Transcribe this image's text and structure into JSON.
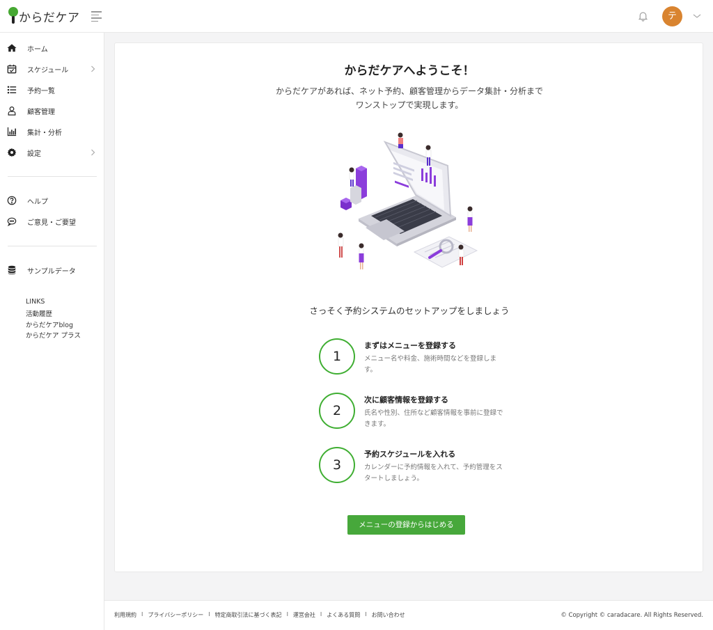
{
  "header": {
    "logo_text": "からだケア",
    "avatar_initial": "テ"
  },
  "sidebar": {
    "items": [
      {
        "label": "ホーム",
        "icon": "home-icon"
      },
      {
        "label": "スケジュール",
        "icon": "calendar-check-icon",
        "has_arrow": true
      },
      {
        "label": "予約一覧",
        "icon": "list-icon"
      },
      {
        "label": "顧客管理",
        "icon": "user-icon"
      },
      {
        "label": "集計・分析",
        "icon": "bar-chart-icon"
      },
      {
        "label": "設定",
        "icon": "gear-icon",
        "has_arrow": true
      }
    ],
    "help_items": [
      {
        "label": "ヘルプ",
        "icon": "question-circle-icon"
      },
      {
        "label": "ご意見・ご要望",
        "icon": "chat-bubble-icon"
      }
    ],
    "sample_data": {
      "label": "サンプルデータ",
      "icon": "database-icon"
    },
    "links_title": "LINKS",
    "links": [
      "活動履歴",
      "からだケアblog",
      "からだケア プラス"
    ]
  },
  "main": {
    "title": "からだケアへようこそ！",
    "desc_line1": "からだケアがあれば、ネット予約、顧客管理からデータ集計・分析まで",
    "desc_line2": "ワンストップで実現します。",
    "setup_text": "さっそく予約システムのセットアップをしましょう",
    "steps": [
      {
        "num": "1",
        "title": "まずはメニューを登録する",
        "desc": "メニュー名や料金、施術時間などを登録します。"
      },
      {
        "num": "2",
        "title": "次に顧客情報を登録する",
        "desc": "氏名や性別、住所など顧客情報を事前に登録できます。"
      },
      {
        "num": "3",
        "title": "予約スケジュールを入れる",
        "desc": "カレンダーに予約情報を入れて、予約管理をスタートしましょう。"
      }
    ],
    "cta_label": "メニューの登録からはじめる"
  },
  "footer": {
    "links": [
      "利用規約",
      "プライバシーポリシー",
      "特定商取引法に基づく表記",
      "運営会社",
      "よくある質問",
      "お問い合わせ"
    ],
    "separator": "I",
    "copyright": "© Copyright © caradacare. All Rights Reserved."
  },
  "colors": {
    "accent_green": "#47a83b",
    "avatar_orange": "#d98430",
    "illustration_purple": "#8b3ddb"
  }
}
